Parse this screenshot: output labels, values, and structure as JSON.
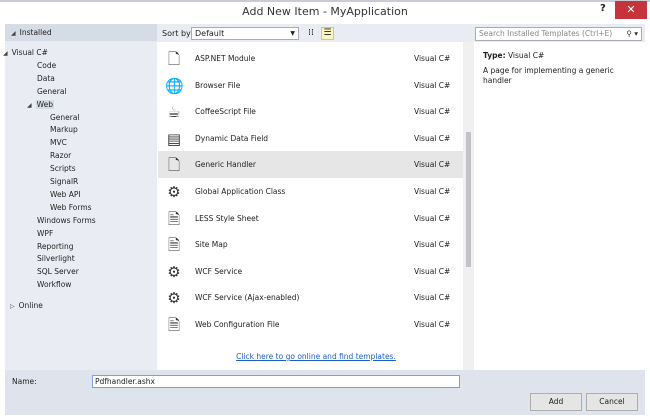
{
  "window": {
    "title": "Add New Item - MyApplication",
    "help": "?",
    "close": "✕"
  },
  "tree": {
    "installed": "Installed",
    "items": [
      {
        "label": "Visual C#",
        "level": 1,
        "expanded": true
      },
      {
        "label": "Code",
        "level": 2
      },
      {
        "label": "Data",
        "level": 2
      },
      {
        "label": "General",
        "level": 2
      },
      {
        "label": "Web",
        "level": 2,
        "expanded": true,
        "selected": true
      },
      {
        "label": "General",
        "level": 3
      },
      {
        "label": "Markup",
        "level": 3
      },
      {
        "label": "MVC",
        "level": 3
      },
      {
        "label": "Razor",
        "level": 3
      },
      {
        "label": "Scripts",
        "level": 3
      },
      {
        "label": "SignalR",
        "level": 3
      },
      {
        "label": "Web API",
        "level": 3
      },
      {
        "label": "Web Forms",
        "level": 3
      },
      {
        "label": "Windows Forms",
        "level": 2
      },
      {
        "label": "WPF",
        "level": 2
      },
      {
        "label": "Reporting",
        "level": 2
      },
      {
        "label": "Silverlight",
        "level": 2
      },
      {
        "label": "SQL Server",
        "level": 2
      },
      {
        "label": "Workflow",
        "level": 2
      }
    ],
    "online": "Online"
  },
  "toolbar": {
    "sort_label": "Sort by:",
    "sort_value": "Default",
    "search_placeholder": "Search Installed Templates (Ctrl+E)"
  },
  "templates": [
    {
      "name": "ASP.NET Module",
      "lang": "Visual C#",
      "icon": "module-file-icon",
      "glyph": "🗋"
    },
    {
      "name": "Browser File",
      "lang": "Visual C#",
      "icon": "globe-icon",
      "glyph": "🌐"
    },
    {
      "name": "CoffeeScript File",
      "lang": "Visual C#",
      "icon": "coffee-cup-icon",
      "glyph": "☕"
    },
    {
      "name": "Dynamic Data Field",
      "lang": "Visual C#",
      "icon": "data-field-icon",
      "glyph": "▤"
    },
    {
      "name": "Generic Handler",
      "lang": "Visual C#",
      "icon": "handler-file-icon",
      "glyph": "🗋",
      "selected": true
    },
    {
      "name": "Global Application Class",
      "lang": "Visual C#",
      "icon": "gear-file-icon",
      "glyph": "⚙"
    },
    {
      "name": "LESS Style Sheet",
      "lang": "Visual C#",
      "icon": "stylesheet-icon",
      "glyph": "🗎"
    },
    {
      "name": "Site Map",
      "lang": "Visual C#",
      "icon": "sitemap-icon",
      "glyph": "🗎"
    },
    {
      "name": "WCF Service",
      "lang": "Visual C#",
      "icon": "wcf-service-icon",
      "glyph": "⚙"
    },
    {
      "name": "WCF Service (Ajax-enabled)",
      "lang": "Visual C#",
      "icon": "wcf-ajax-icon",
      "glyph": "⚙"
    },
    {
      "name": "Web Configuration File",
      "lang": "Visual C#",
      "icon": "config-file-icon",
      "glyph": "🗎"
    }
  ],
  "online_link": "Click here to go online and find templates.",
  "details": {
    "type_label": "Type:",
    "type_value": "Visual C#",
    "description": "A page for implementing a generic handler"
  },
  "bottom": {
    "name_label": "Name:",
    "name_value": "Pdfhandler.ashx",
    "add": "Add",
    "cancel": "Cancel"
  }
}
